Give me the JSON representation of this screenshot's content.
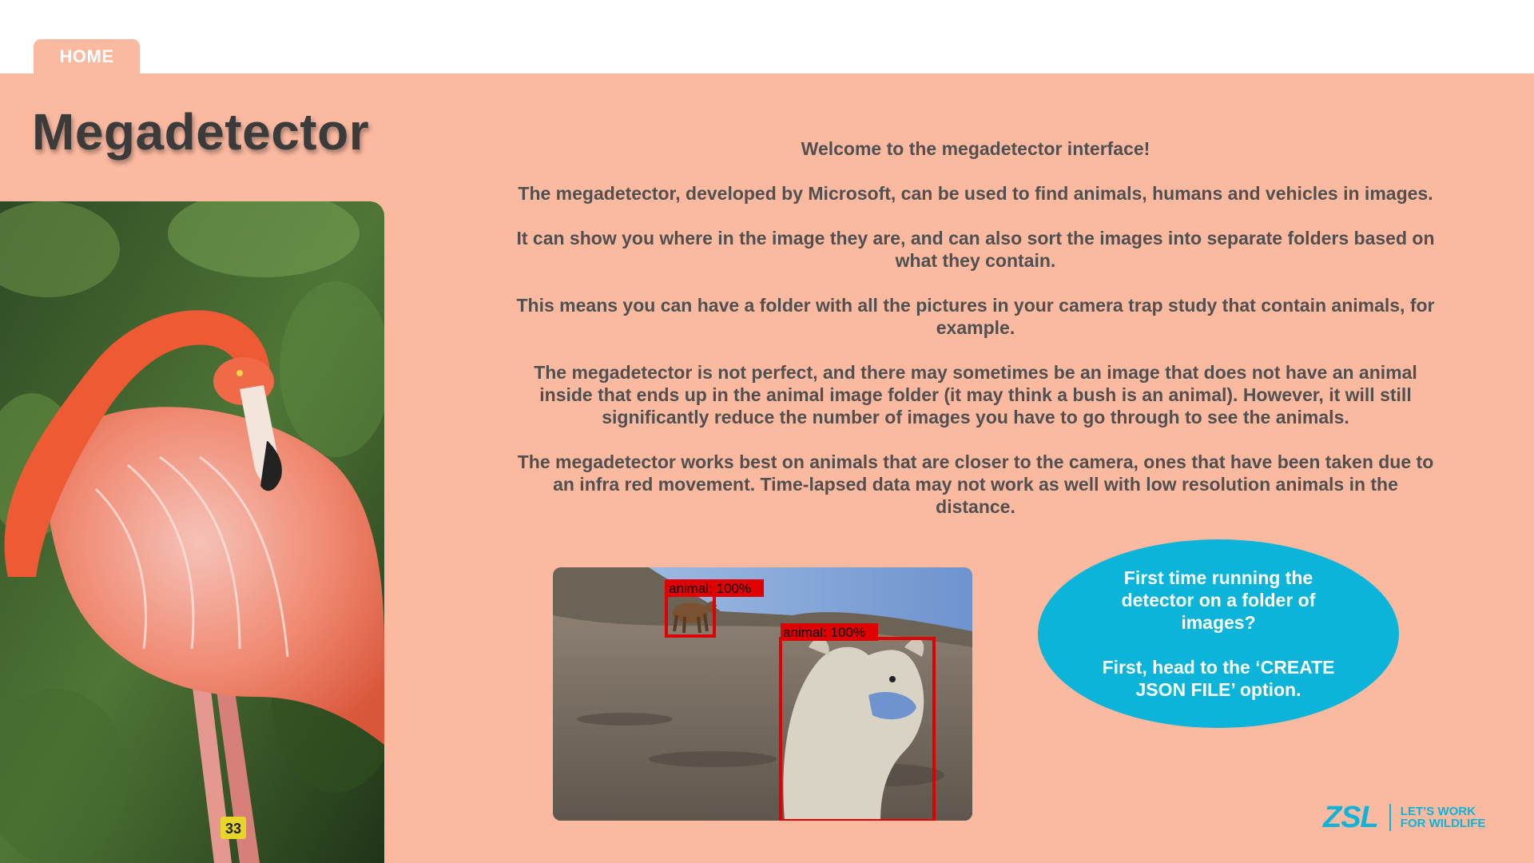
{
  "nav": {
    "home_tab": "HOME"
  },
  "page": {
    "title": "Megadetector"
  },
  "intro": [
    "Welcome to the megadetector interface!",
    "The megadetector, developed by Microsoft, can be used to find animals, humans and vehicles in images.",
    "It can show you where in the image they are, and can also sort the images into separate folders based on what they contain.",
    "This means you can have a folder with all the pictures in your camera trap study that contain animals, for example.",
    "The megadetector is not perfect, and there may sometimes be an image that does not have an animal inside that ends up in the animal image folder (it may think a bush is an animal). However, it will still significantly reduce the number of images you have to go through to see the animals.",
    "The megadetector works best on animals that are closer to the camera, ones that have been taken due to an infra red movement. Time-lapsed data may not work as well with low resolution animals in the distance."
  ],
  "example_image": {
    "detections": [
      "animal: 100%",
      "animal: 100%"
    ],
    "tag_number": "33"
  },
  "bubble": {
    "line1": "First time running the detector on a folder of images?",
    "line2": "First, head to the ‘CREATE JSON FILE’ option."
  },
  "logo": {
    "name": "ZSL",
    "tagline_1": "LET’S WORK",
    "tagline_2": "FOR WILDLIFE"
  },
  "colors": {
    "panel": "#fbb9a0",
    "accent": "#0db4da",
    "text": "#505050",
    "detection_box": "#e00000"
  }
}
